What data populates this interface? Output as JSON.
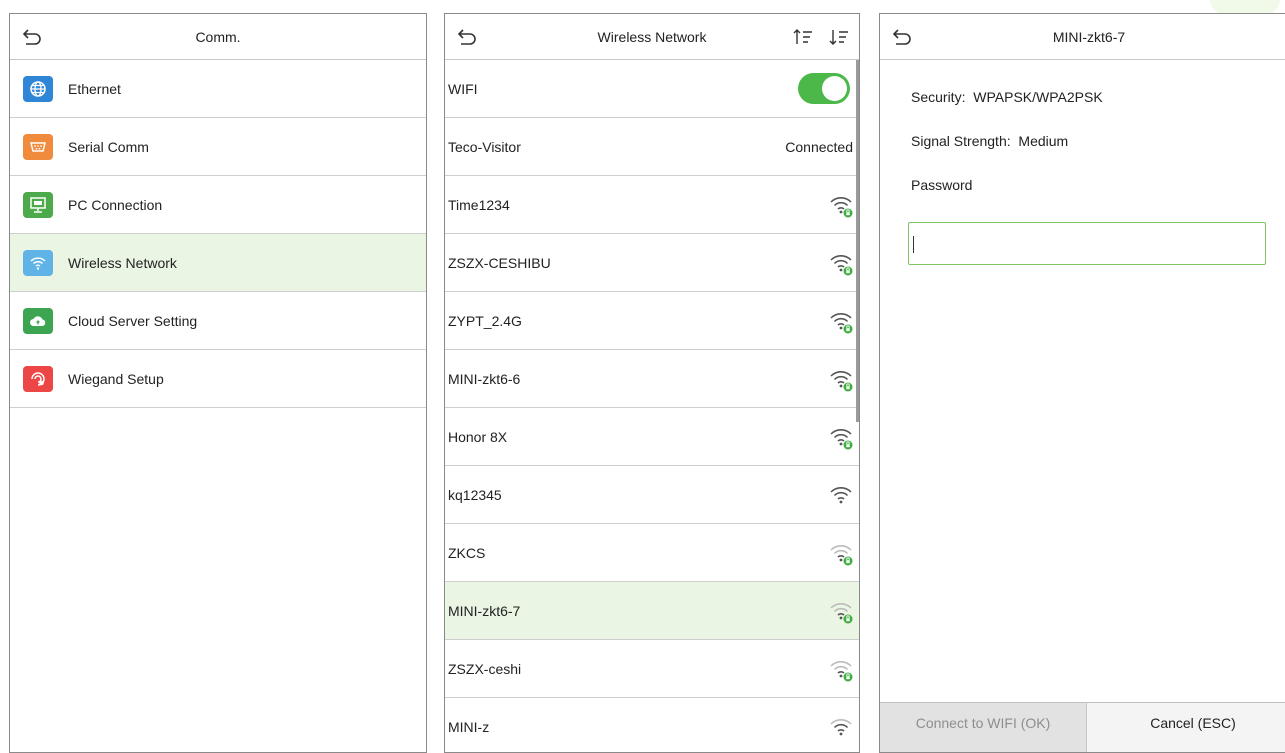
{
  "comm": {
    "title": "Comm.",
    "items": [
      {
        "label": "Ethernet",
        "icon": "globe-icon",
        "color": "#2f86d6"
      },
      {
        "label": "Serial Comm",
        "icon": "serial-port-icon",
        "color": "#f08a3c"
      },
      {
        "label": "PC Connection",
        "icon": "monitor-icon",
        "color": "#4caa4a"
      },
      {
        "label": "Wireless Network",
        "icon": "wifi-icon",
        "color": "#5fb3e6"
      },
      {
        "label": "Cloud Server Setting",
        "icon": "cloud-icon",
        "color": "#3da552"
      },
      {
        "label": "Wiegand Setup",
        "icon": "wiegand-icon",
        "color": "#ec4646"
      }
    ]
  },
  "wireless": {
    "title": "Wireless Network",
    "wifi_label": "WIFI",
    "wifi_enabled": true,
    "networks": [
      {
        "name": "Teco-Visitor",
        "status": "Connected"
      },
      {
        "name": "Time1234",
        "signal": "strong",
        "locked": true
      },
      {
        "name": "ZSZX-CESHIBU",
        "signal": "strong",
        "locked": true
      },
      {
        "name": "ZYPT_2.4G",
        "signal": "strong",
        "locked": true
      },
      {
        "name": "MINI-zkt6-6",
        "signal": "strong",
        "locked": true
      },
      {
        "name": "Honor 8X",
        "signal": "strong",
        "locked": true
      },
      {
        "name": "kq12345",
        "signal": "strong",
        "locked": false
      },
      {
        "name": "ZKCS",
        "signal": "weak",
        "locked": true
      },
      {
        "name": "MINI-zkt6-7",
        "signal": "weak",
        "locked": true
      },
      {
        "name": "ZSZX-ceshi",
        "signal": "weak",
        "locked": true
      },
      {
        "name": "MINI-z",
        "signal": "medium",
        "locked": false
      }
    ],
    "selected": "MINI-zkt6-7"
  },
  "detail": {
    "title": "MINI-zkt6-7",
    "security_label": "Security:",
    "security_value": "WPAPSK/WPA2PSK",
    "signal_label": "Signal Strength:",
    "signal_value": "Medium",
    "password_label": "Password",
    "password_value": "",
    "connect_label": "Connect to WIFI (OK)",
    "cancel_label": "Cancel (ESC)"
  },
  "colors": {
    "accent": "#4cb84a",
    "selected_row": "#eaf5e4"
  }
}
